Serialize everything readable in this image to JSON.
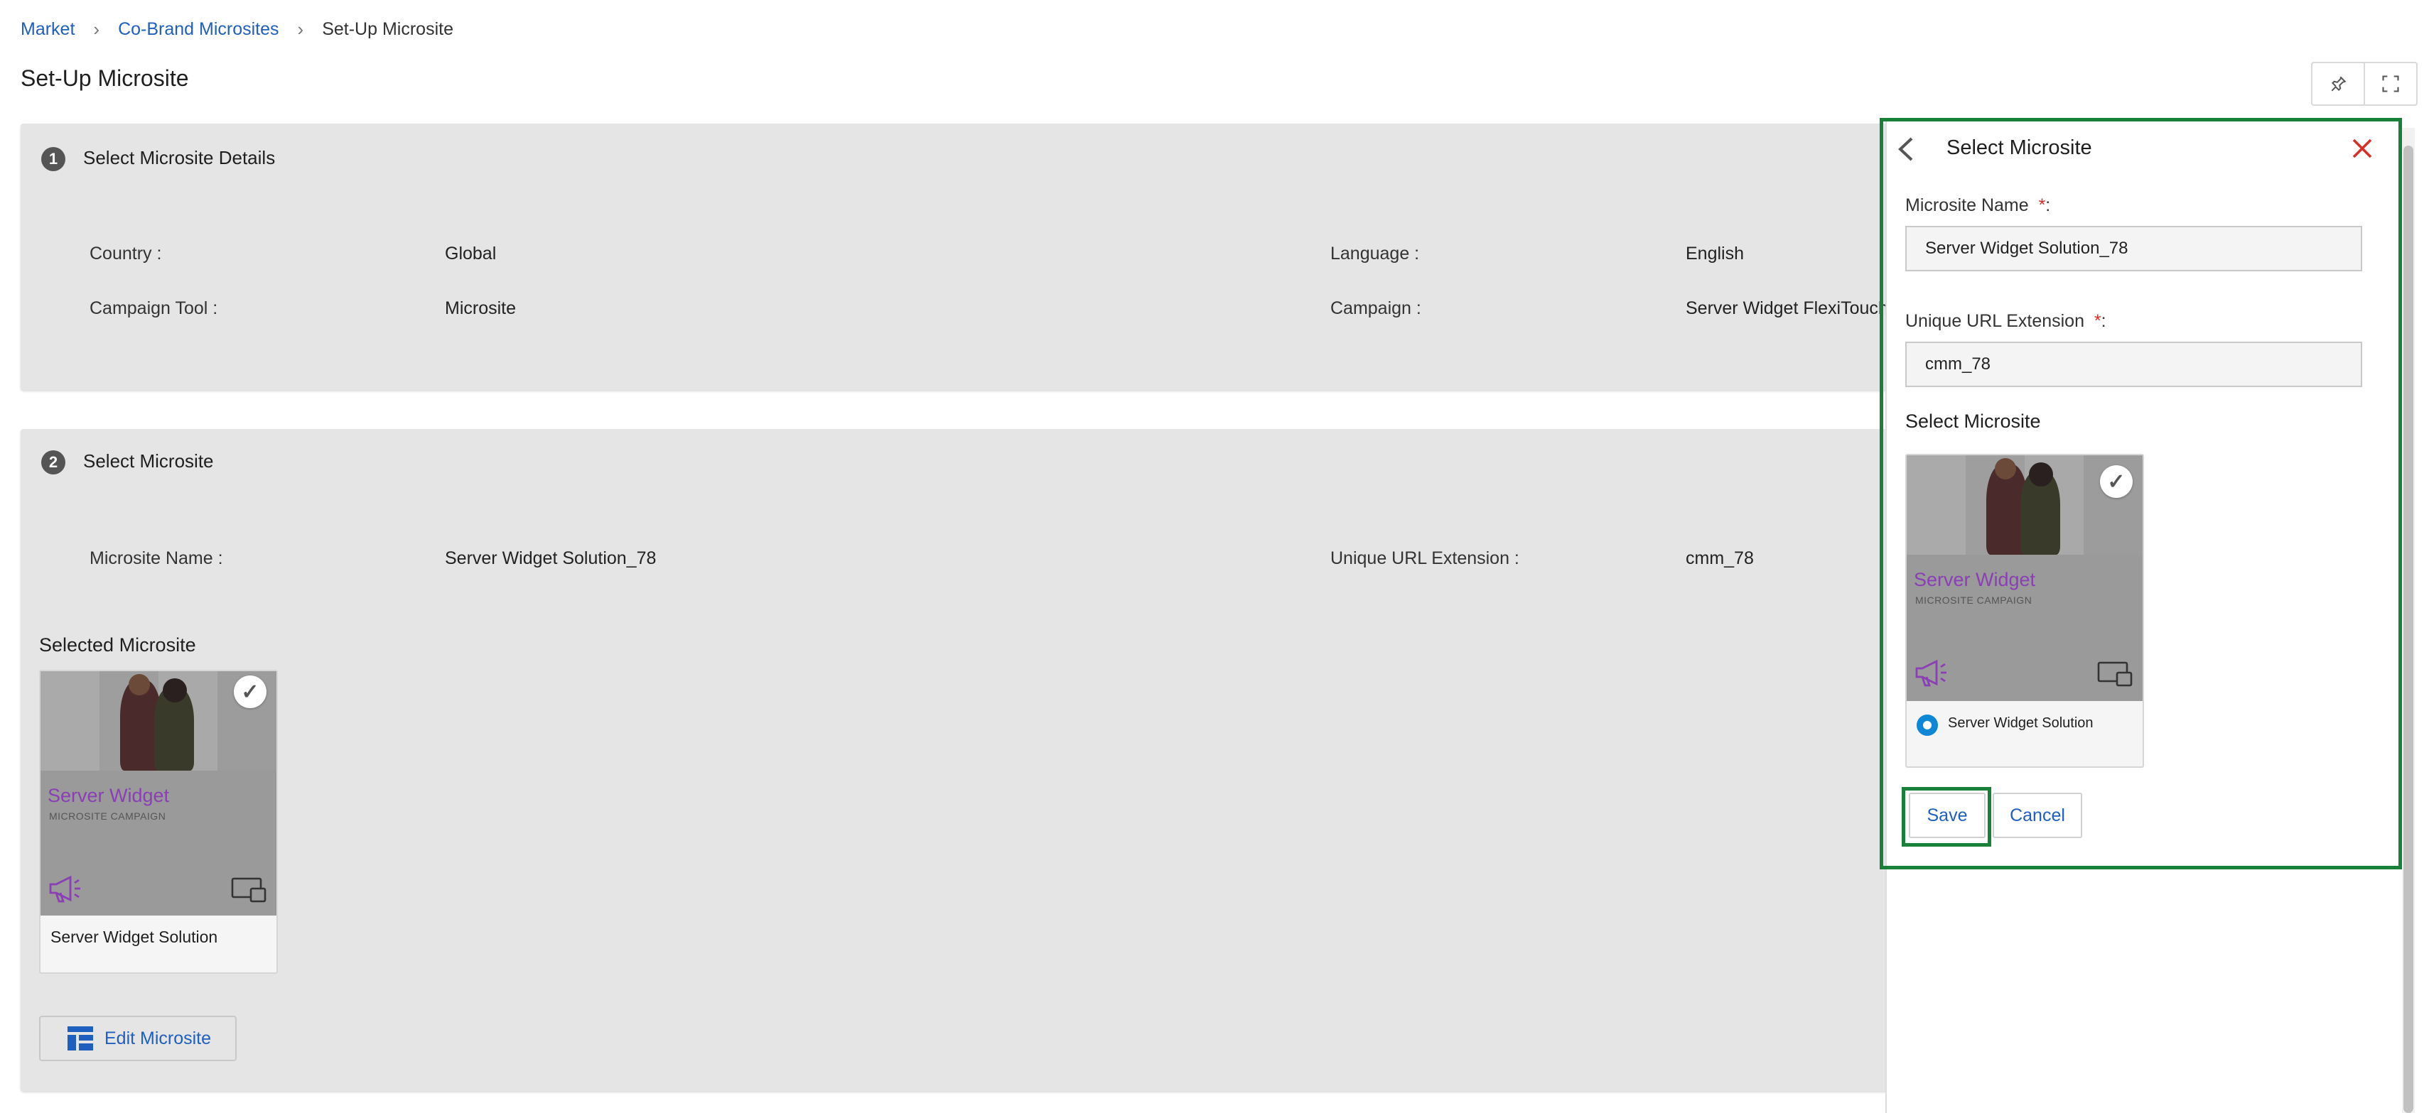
{
  "breadcrumb": {
    "items": [
      "Market",
      "Co-Brand Microsites"
    ],
    "current": "Set-Up Microsite"
  },
  "page": {
    "title": "Set-Up Microsite"
  },
  "toolbar": {
    "pin_icon": "pin-icon",
    "expand_icon": "fullscreen-icon"
  },
  "step1": {
    "number": "1",
    "title": "Select Microsite Details",
    "country_label": "Country :",
    "country_value": "Global",
    "language_label": "Language :",
    "language_value": "English",
    "campaign_tool_label": "Campaign Tool :",
    "campaign_tool_value": "Microsite",
    "campaign_label": "Campaign :",
    "campaign_value": "Server Widget FlexiTouch"
  },
  "step2": {
    "number": "2",
    "title": "Select Microsite",
    "microsite_name_label": "Microsite Name :",
    "microsite_name_value": "Server Widget Solution_78",
    "url_label": "Unique URL Extension :",
    "url_value": "cmm_78",
    "selected_heading": "Selected Microsite",
    "tile": {
      "title": "Server Widget",
      "subtitle": "MICROSITE CAMPAIGN",
      "label": "Server Widget Solution"
    },
    "edit_button": "Edit Microsite"
  },
  "panel": {
    "title": "Select Microsite",
    "name_label": "Microsite Name",
    "name_required": "*",
    "name_suffix": ":",
    "name_value": "Server Widget Solution_78",
    "url_label": "Unique URL Extension",
    "url_required": "*",
    "url_suffix": ":",
    "url_value": "cmm_78",
    "select_heading": "Select Microsite",
    "tile": {
      "title": "Server Widget",
      "subtitle": "MICROSITE CAMPAIGN",
      "label": "Server Widget Solution"
    },
    "save": "Save",
    "cancel": "Cancel"
  },
  "colors": {
    "accent": "#1f5fbf",
    "highlight": "#188038",
    "close": "#d93025",
    "brand_purple": "#8a3fb5",
    "radio": "#0d87d6"
  }
}
